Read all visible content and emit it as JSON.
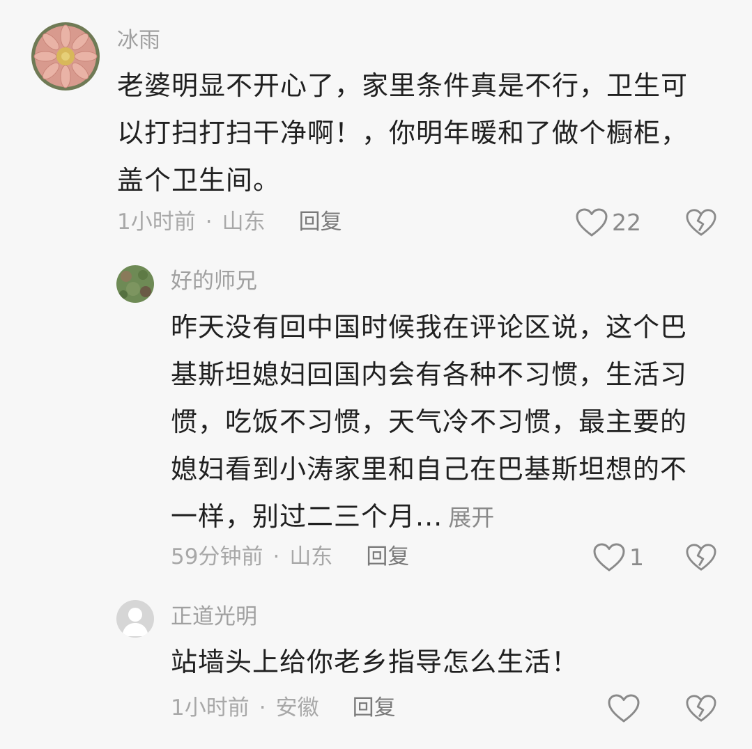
{
  "comments": [
    {
      "name": "冰雨",
      "lines": [
        "老婆明显不开心了，家里条件真是不行，卫生可",
        "以打扫打扫干净啊！，你明年暖和了做个橱柜，",
        "盖个卫生间。"
      ],
      "time": "1小时前",
      "location": "山东",
      "reply_label": "回复",
      "likes": "22"
    },
    {
      "name": "好的师兄",
      "lines": [
        "昨天没有回中国时候我在评论区说，这个巴",
        "基斯坦媳妇回国内会有各种不习惯，生活习",
        "惯，吃饭不习惯，天气冷不习惯，最主要的",
        "媳妇看到小涛家里和自己在巴基斯坦想的不",
        "一样，别过二三个月..."
      ],
      "expand_label": "展开",
      "time": "59分钟前",
      "location": "山东",
      "reply_label": "回复",
      "likes": "1"
    },
    {
      "name": "正道光明",
      "lines": [
        "站墙头上给你老乡指导怎么生活！"
      ],
      "time": "1小时前",
      "location": "安徽",
      "reply_label": "回复",
      "likes": ""
    }
  ],
  "separator": "·",
  "icons": {
    "like": "heart-outline-icon",
    "dislike": "broken-heart-icon"
  },
  "colors": {
    "background": "#f7f7f7",
    "text": "#202020",
    "muted": "#a0a0a0"
  }
}
